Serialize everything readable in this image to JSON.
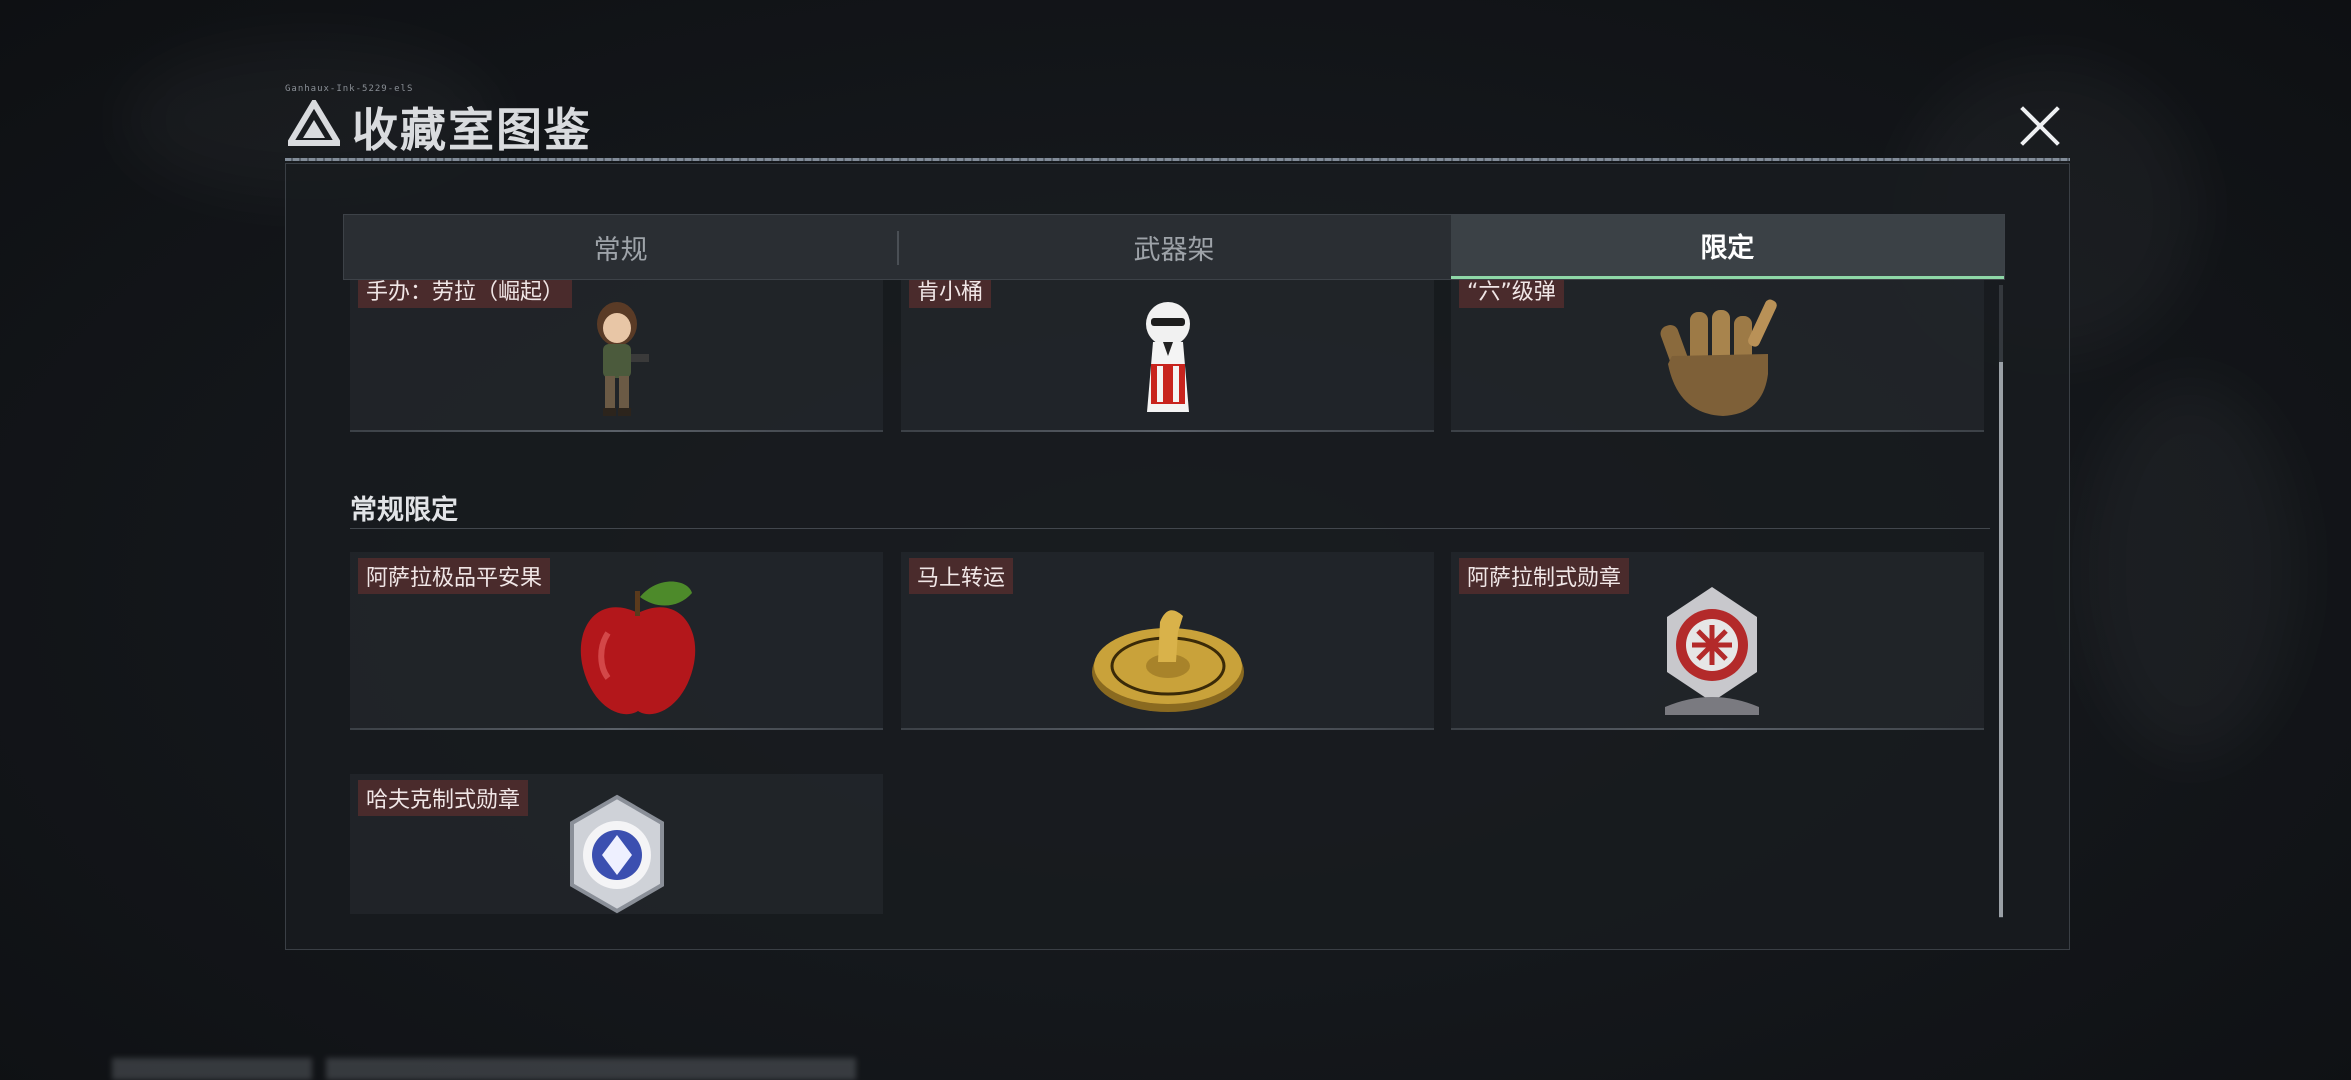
{
  "window": {
    "title": "收藏室图鉴",
    "tiny_caption": "Ganhaux-Ink-5229-elS"
  },
  "tabs": [
    {
      "label": "常规",
      "active": false
    },
    {
      "label": "武器架",
      "active": false
    },
    {
      "label": "限定",
      "active": true
    }
  ],
  "top_row_items": [
    {
      "label": "手办：劳拉（崛起）",
      "icon": "lara-figure-icon"
    },
    {
      "label": "肯小桶",
      "icon": "kfc-figure-icon"
    },
    {
      "label": "“六”级弹",
      "icon": "bullet-hand-icon"
    }
  ],
  "section": {
    "title": "常规限定",
    "items": [
      {
        "label": "阿萨拉极品平安果",
        "icon": "apple-icon"
      },
      {
        "label": "马上转运",
        "icon": "horse-wheel-icon"
      },
      {
        "label": "阿萨拉制式勋章",
        "icon": "asala-medal-icon"
      },
      {
        "label": "哈夫克制式勋章",
        "icon": "haavk-medal-icon"
      }
    ]
  },
  "colors": {
    "accent": "#8fd8a8",
    "label_bg": "#4a2b2c",
    "panel_bg": "#181b1f"
  }
}
